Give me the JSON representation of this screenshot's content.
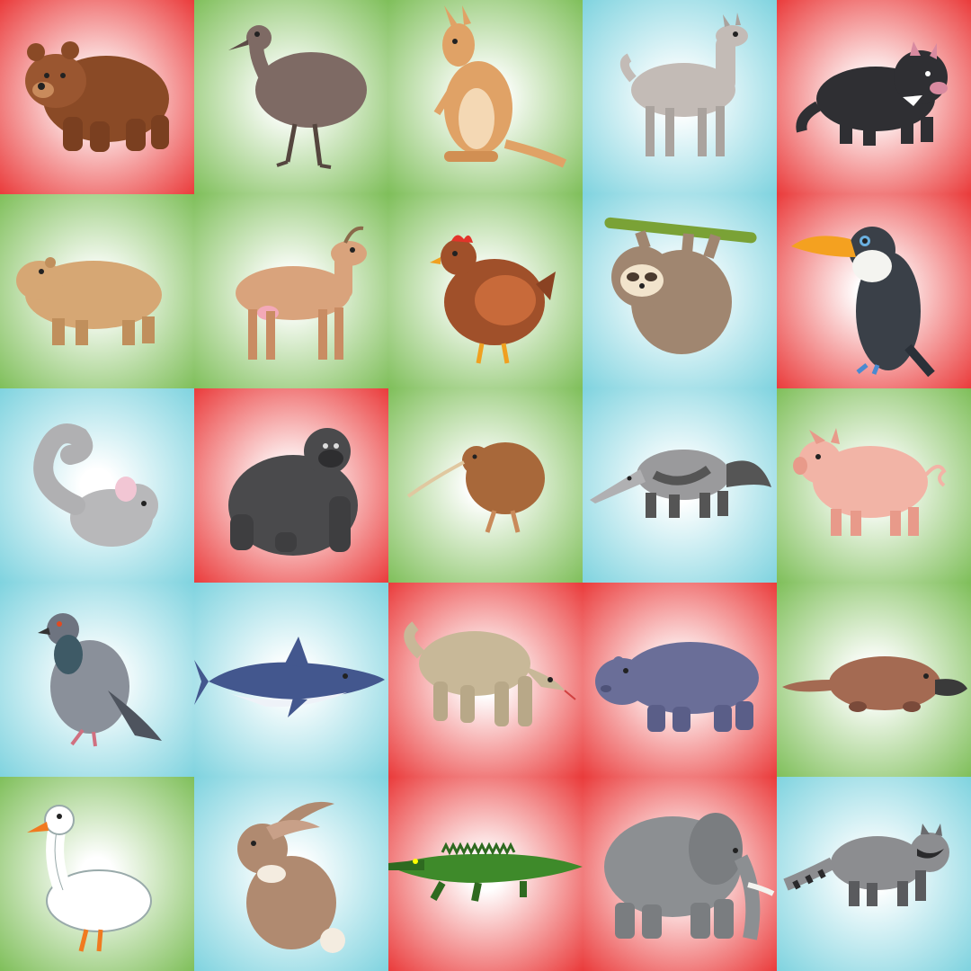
{
  "board": {
    "tile_colors": {
      "red": {
        "center": "#ffffff",
        "edge": "#ea3b3b"
      },
      "green": {
        "center": "#ffffff",
        "edge": "#7fbf5a"
      },
      "blue": {
        "center": "#ffffff",
        "edge": "#7fd3df"
      }
    },
    "tiles": [
      {
        "animal": "bear",
        "color": "red"
      },
      {
        "animal": "emu",
        "color": "green"
      },
      {
        "animal": "kangaroo",
        "color": "green"
      },
      {
        "animal": "llama",
        "color": "blue"
      },
      {
        "animal": "tasmanian-devil",
        "color": "red"
      },
      {
        "animal": "capybara",
        "color": "green"
      },
      {
        "animal": "goat",
        "color": "green"
      },
      {
        "animal": "hen",
        "color": "green"
      },
      {
        "animal": "sloth",
        "color": "blue"
      },
      {
        "animal": "toucan",
        "color": "red"
      },
      {
        "animal": "chinchilla",
        "color": "blue"
      },
      {
        "animal": "gorilla",
        "color": "red"
      },
      {
        "animal": "kiwi",
        "color": "green"
      },
      {
        "animal": "anteater",
        "color": "blue"
      },
      {
        "animal": "pig",
        "color": "green"
      },
      {
        "animal": "pigeon",
        "color": "blue"
      },
      {
        "animal": "shark",
        "color": "blue"
      },
      {
        "animal": "komodo-dragon",
        "color": "red"
      },
      {
        "animal": "hippopotamus",
        "color": "red"
      },
      {
        "animal": "platypus",
        "color": "green"
      },
      {
        "animal": "goose",
        "color": "green"
      },
      {
        "animal": "rabbit",
        "color": "blue"
      },
      {
        "animal": "crocodile",
        "color": "red"
      },
      {
        "animal": "elephant",
        "color": "red"
      },
      {
        "animal": "raccoon",
        "color": "blue"
      }
    ]
  }
}
